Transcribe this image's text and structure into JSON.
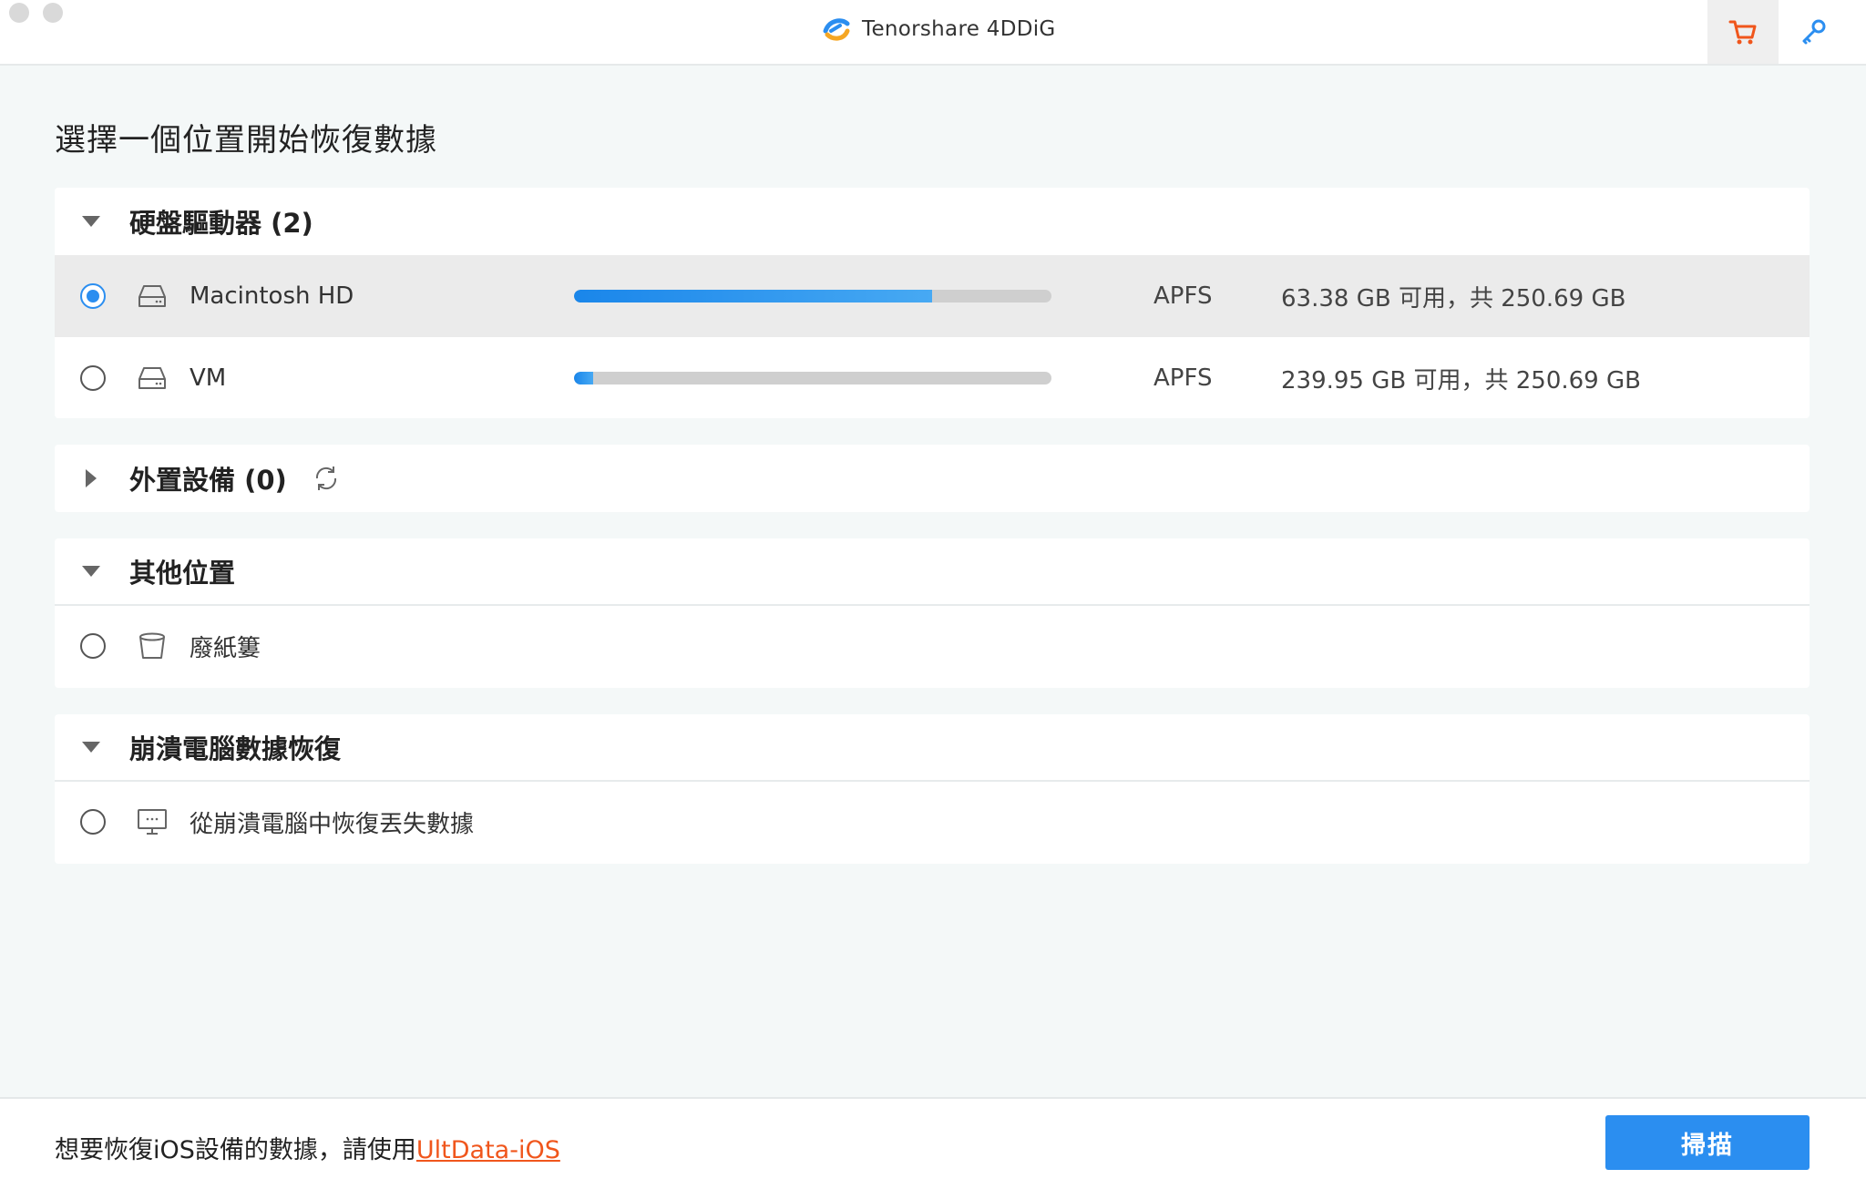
{
  "window": {
    "app_name": "Tenorshare 4DDiG"
  },
  "toolbar": {
    "cart_icon": "cart-icon",
    "key_icon": "key-icon",
    "accent_cart": "#f0561c",
    "accent_key": "#2b8ef0"
  },
  "page": {
    "title": "選擇一個位置開始恢復數據"
  },
  "sections": {
    "hard_drives": {
      "title": "硬盤驅動器 (2)",
      "expanded": true,
      "drives": [
        {
          "name": "Macintosh HD",
          "selected": true,
          "used_fraction": 0.75,
          "filesystem": "APFS",
          "capacity": "63.38 GB 可用，共 250.69 GB"
        },
        {
          "name": "VM",
          "selected": false,
          "used_fraction": 0.04,
          "filesystem": "APFS",
          "capacity": "239.95 GB 可用，共 250.69 GB"
        }
      ]
    },
    "external": {
      "title": "外置設備 (0)",
      "expanded": false
    },
    "other": {
      "title": "其他位置",
      "expanded": true,
      "items": [
        {
          "label": "廢紙簍",
          "selected": false
        }
      ]
    },
    "crash": {
      "title": "崩潰電腦數據恢復",
      "expanded": true,
      "items": [
        {
          "label": "從崩潰電腦中恢復丟失數據",
          "selected": false
        }
      ]
    }
  },
  "footer": {
    "text": "想要恢復iOS設備的數據，請使用",
    "link": "UltData-iOS",
    "scan_button": "掃描"
  }
}
